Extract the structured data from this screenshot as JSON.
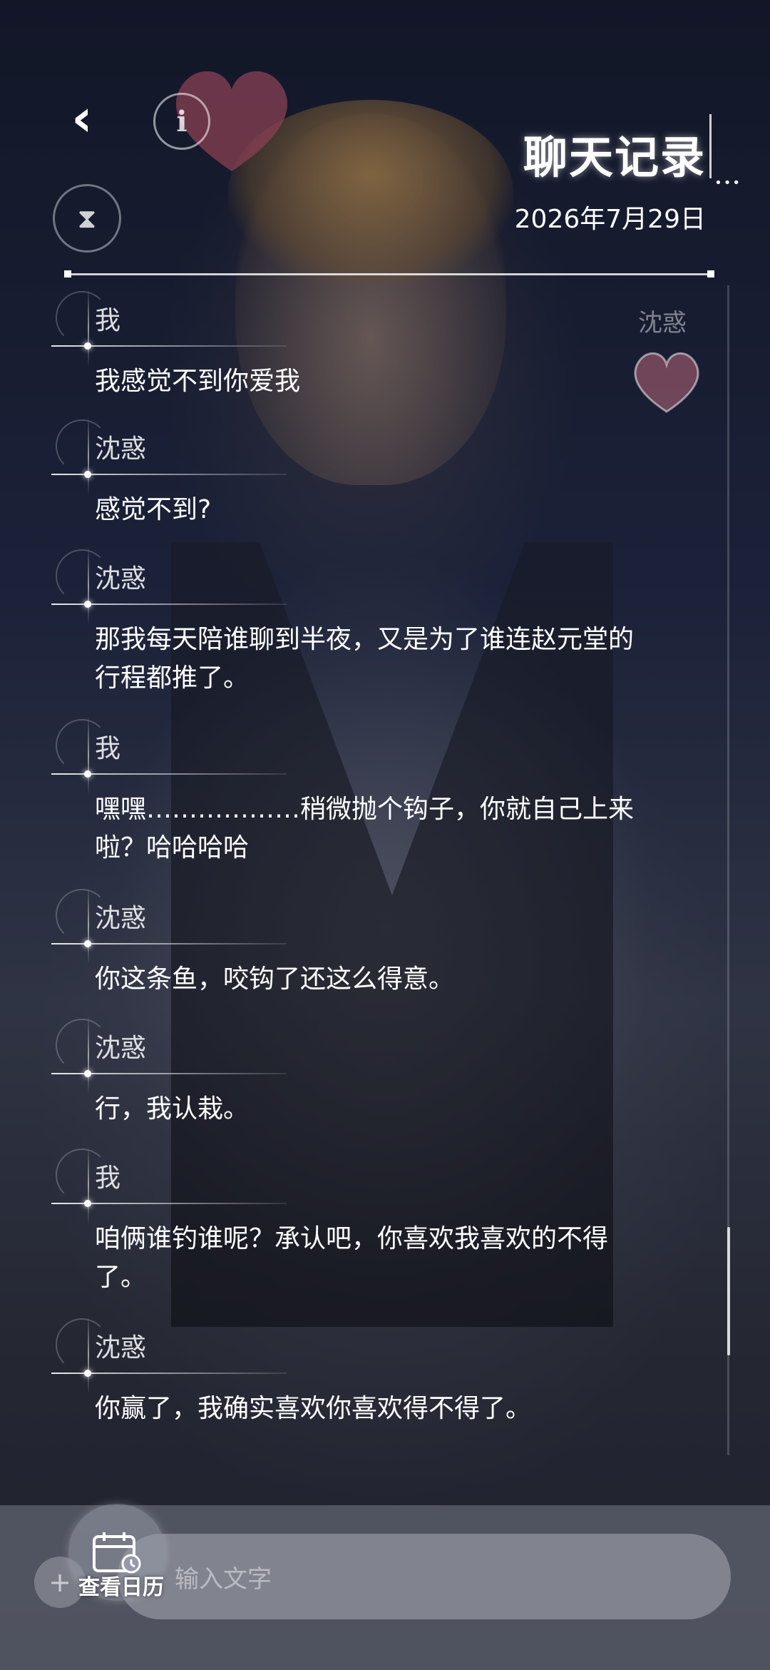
{
  "header": {
    "title": "聊天记录",
    "date": "2026年7月29日"
  },
  "icons": {
    "back": "chevron-left-icon",
    "info": "info-icon",
    "hourglass": "hourglass-icon",
    "calendar": "calendar-icon"
  },
  "messages": [
    {
      "sender": "我",
      "text": "我感觉不到你爱我"
    },
    {
      "sender": "沈惑",
      "text": "感觉不到?"
    },
    {
      "sender": "沈惑",
      "text": "那我每天陪谁聊到半夜，又是为了谁连赵元堂的行程都推了。"
    },
    {
      "sender": "我",
      "text": "嘿嘿………………稍微抛个钩子，你就自己上来啦？哈哈哈哈"
    },
    {
      "sender": "沈惑",
      "text": "你这条鱼，咬钩了还这么得意。"
    },
    {
      "sender": "沈惑",
      "text": "行，我认栽。"
    },
    {
      "sender": "我",
      "text": "咱俩谁钓谁呢？承认吧，你喜欢我喜欢的不得了。"
    },
    {
      "sender": "沈惑",
      "text": "你赢了，我确实喜欢你喜欢得不得了。"
    }
  ],
  "side_deco": {
    "name": "沈惑"
  },
  "bottom": {
    "calendar_label": "查看日历",
    "input_placeholder": "输入文字"
  },
  "colors": {
    "text": "#ffffff",
    "accent_heart": "#c4536a"
  }
}
